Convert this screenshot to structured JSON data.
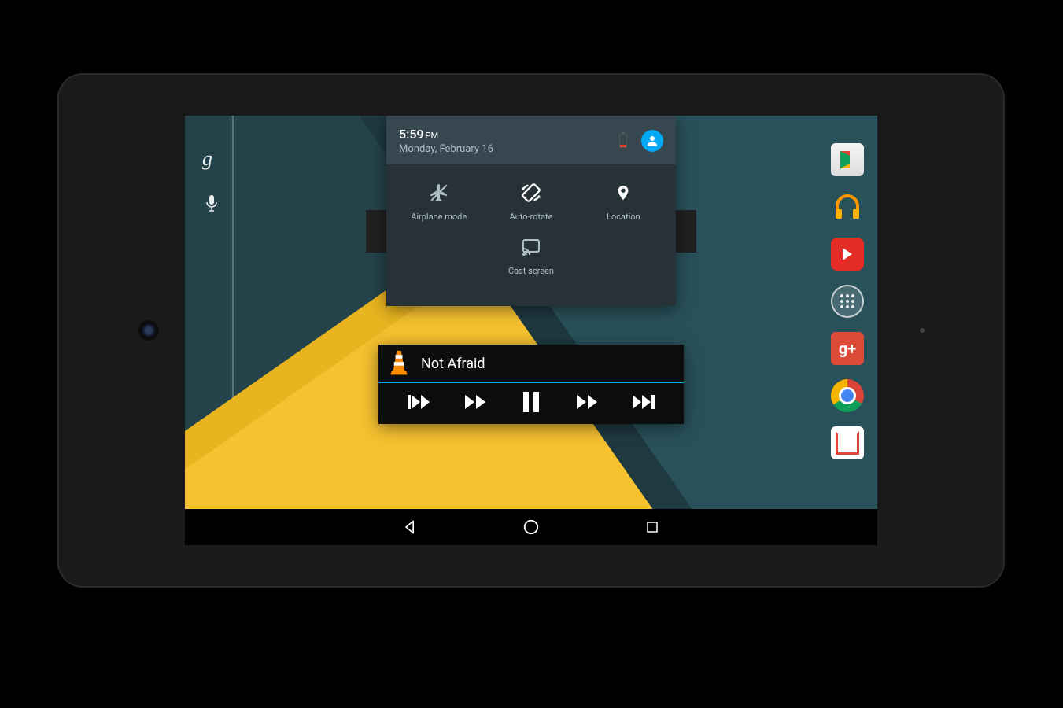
{
  "time": "5:59",
  "ampm": "PM",
  "date": "Monday, February 16",
  "quick_settings": {
    "tiles": [
      {
        "id": "airplane",
        "label": "Airplane mode"
      },
      {
        "id": "autorotate",
        "label": "Auto-rotate"
      },
      {
        "id": "location",
        "label": "Location"
      },
      {
        "id": "cast",
        "label": "Cast screen"
      }
    ]
  },
  "media": {
    "app": "VLC",
    "title": "Not Afraid"
  },
  "apps": [
    {
      "id": "play-store",
      "label": "Play Store"
    },
    {
      "id": "play-music",
      "label": "Play Music"
    },
    {
      "id": "youtube",
      "label": "YouTube"
    },
    {
      "id": "all-apps",
      "label": "All apps"
    },
    {
      "id": "google-plus",
      "label": "Google+"
    },
    {
      "id": "chrome",
      "label": "Chrome"
    },
    {
      "id": "gmail",
      "label": "Gmail"
    }
  ],
  "nav": {
    "back": "Back",
    "home": "Home",
    "recent": "Recent apps"
  },
  "search": {
    "provider": "Google",
    "voice": "Voice search"
  }
}
